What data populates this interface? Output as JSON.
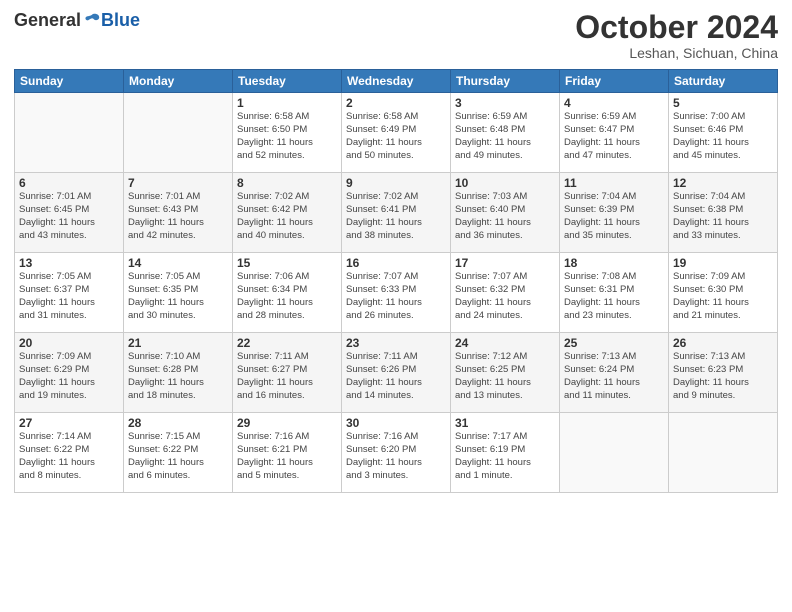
{
  "header": {
    "logo_general": "General",
    "logo_blue": "Blue",
    "month_title": "October 2024",
    "location": "Leshan, Sichuan, China"
  },
  "days_of_week": [
    "Sunday",
    "Monday",
    "Tuesday",
    "Wednesday",
    "Thursday",
    "Friday",
    "Saturday"
  ],
  "weeks": [
    [
      {
        "num": "",
        "info": ""
      },
      {
        "num": "",
        "info": ""
      },
      {
        "num": "1",
        "info": "Sunrise: 6:58 AM\nSunset: 6:50 PM\nDaylight: 11 hours\nand 52 minutes."
      },
      {
        "num": "2",
        "info": "Sunrise: 6:58 AM\nSunset: 6:49 PM\nDaylight: 11 hours\nand 50 minutes."
      },
      {
        "num": "3",
        "info": "Sunrise: 6:59 AM\nSunset: 6:48 PM\nDaylight: 11 hours\nand 49 minutes."
      },
      {
        "num": "4",
        "info": "Sunrise: 6:59 AM\nSunset: 6:47 PM\nDaylight: 11 hours\nand 47 minutes."
      },
      {
        "num": "5",
        "info": "Sunrise: 7:00 AM\nSunset: 6:46 PM\nDaylight: 11 hours\nand 45 minutes."
      }
    ],
    [
      {
        "num": "6",
        "info": "Sunrise: 7:01 AM\nSunset: 6:45 PM\nDaylight: 11 hours\nand 43 minutes."
      },
      {
        "num": "7",
        "info": "Sunrise: 7:01 AM\nSunset: 6:43 PM\nDaylight: 11 hours\nand 42 minutes."
      },
      {
        "num": "8",
        "info": "Sunrise: 7:02 AM\nSunset: 6:42 PM\nDaylight: 11 hours\nand 40 minutes."
      },
      {
        "num": "9",
        "info": "Sunrise: 7:02 AM\nSunset: 6:41 PM\nDaylight: 11 hours\nand 38 minutes."
      },
      {
        "num": "10",
        "info": "Sunrise: 7:03 AM\nSunset: 6:40 PM\nDaylight: 11 hours\nand 36 minutes."
      },
      {
        "num": "11",
        "info": "Sunrise: 7:04 AM\nSunset: 6:39 PM\nDaylight: 11 hours\nand 35 minutes."
      },
      {
        "num": "12",
        "info": "Sunrise: 7:04 AM\nSunset: 6:38 PM\nDaylight: 11 hours\nand 33 minutes."
      }
    ],
    [
      {
        "num": "13",
        "info": "Sunrise: 7:05 AM\nSunset: 6:37 PM\nDaylight: 11 hours\nand 31 minutes."
      },
      {
        "num": "14",
        "info": "Sunrise: 7:05 AM\nSunset: 6:35 PM\nDaylight: 11 hours\nand 30 minutes."
      },
      {
        "num": "15",
        "info": "Sunrise: 7:06 AM\nSunset: 6:34 PM\nDaylight: 11 hours\nand 28 minutes."
      },
      {
        "num": "16",
        "info": "Sunrise: 7:07 AM\nSunset: 6:33 PM\nDaylight: 11 hours\nand 26 minutes."
      },
      {
        "num": "17",
        "info": "Sunrise: 7:07 AM\nSunset: 6:32 PM\nDaylight: 11 hours\nand 24 minutes."
      },
      {
        "num": "18",
        "info": "Sunrise: 7:08 AM\nSunset: 6:31 PM\nDaylight: 11 hours\nand 23 minutes."
      },
      {
        "num": "19",
        "info": "Sunrise: 7:09 AM\nSunset: 6:30 PM\nDaylight: 11 hours\nand 21 minutes."
      }
    ],
    [
      {
        "num": "20",
        "info": "Sunrise: 7:09 AM\nSunset: 6:29 PM\nDaylight: 11 hours\nand 19 minutes."
      },
      {
        "num": "21",
        "info": "Sunrise: 7:10 AM\nSunset: 6:28 PM\nDaylight: 11 hours\nand 18 minutes."
      },
      {
        "num": "22",
        "info": "Sunrise: 7:11 AM\nSunset: 6:27 PM\nDaylight: 11 hours\nand 16 minutes."
      },
      {
        "num": "23",
        "info": "Sunrise: 7:11 AM\nSunset: 6:26 PM\nDaylight: 11 hours\nand 14 minutes."
      },
      {
        "num": "24",
        "info": "Sunrise: 7:12 AM\nSunset: 6:25 PM\nDaylight: 11 hours\nand 13 minutes."
      },
      {
        "num": "25",
        "info": "Sunrise: 7:13 AM\nSunset: 6:24 PM\nDaylight: 11 hours\nand 11 minutes."
      },
      {
        "num": "26",
        "info": "Sunrise: 7:13 AM\nSunset: 6:23 PM\nDaylight: 11 hours\nand 9 minutes."
      }
    ],
    [
      {
        "num": "27",
        "info": "Sunrise: 7:14 AM\nSunset: 6:22 PM\nDaylight: 11 hours\nand 8 minutes."
      },
      {
        "num": "28",
        "info": "Sunrise: 7:15 AM\nSunset: 6:22 PM\nDaylight: 11 hours\nand 6 minutes."
      },
      {
        "num": "29",
        "info": "Sunrise: 7:16 AM\nSunset: 6:21 PM\nDaylight: 11 hours\nand 5 minutes."
      },
      {
        "num": "30",
        "info": "Sunrise: 7:16 AM\nSunset: 6:20 PM\nDaylight: 11 hours\nand 3 minutes."
      },
      {
        "num": "31",
        "info": "Sunrise: 7:17 AM\nSunset: 6:19 PM\nDaylight: 11 hours\nand 1 minute."
      },
      {
        "num": "",
        "info": ""
      },
      {
        "num": "",
        "info": ""
      }
    ]
  ]
}
